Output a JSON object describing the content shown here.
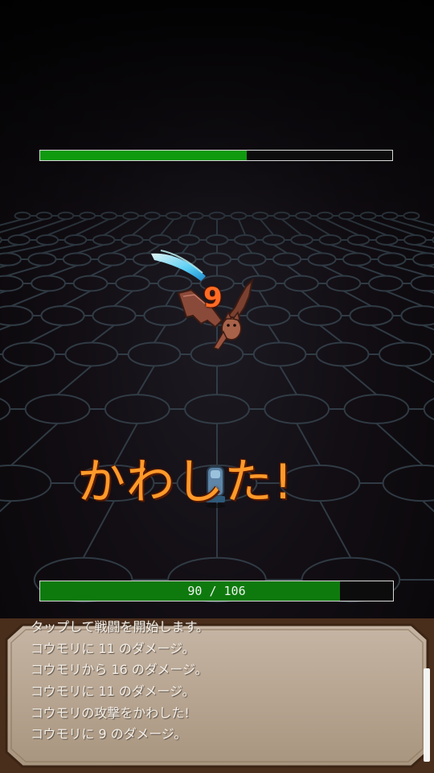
{
  "enemy": {
    "name": "コウモリ",
    "hp_fraction": 0.587
  },
  "effects": {
    "damage_number": "9",
    "dodge_text": "かわした!"
  },
  "player": {
    "hp_text": "90 / 106",
    "hp_current": 90,
    "hp_max": 106
  },
  "log": {
    "lines": [
      "タップして戦闘を開始します。",
      "コウモリに 11 のダメージ。",
      "コウモリから 16 のダメージ。",
      "コウモリに 11 のダメージ。",
      "コウモリの攻撃をかわした!",
      "コウモリに 9 のダメージ。"
    ]
  },
  "colors": {
    "hp_bar": "#109a10",
    "dodge_text": "#ff9a2a",
    "damage_number": "#ff6b24",
    "log_panel": "#bba99a"
  }
}
